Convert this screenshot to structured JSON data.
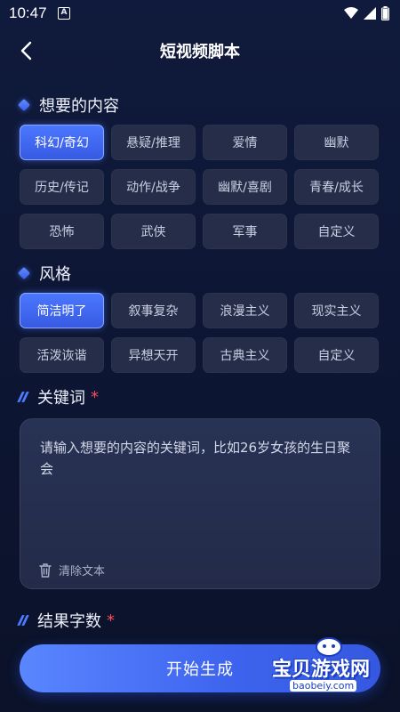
{
  "status_bar": {
    "time": "10:47",
    "notif_letter": "A"
  },
  "header": {
    "title": "短视频脚本"
  },
  "content_section": {
    "title": "想要的内容",
    "options": [
      {
        "label": "科幻/奇幻",
        "selected": true
      },
      {
        "label": "悬疑/推理",
        "selected": false
      },
      {
        "label": "爱情",
        "selected": false
      },
      {
        "label": "幽默",
        "selected": false
      },
      {
        "label": "历史/传记",
        "selected": false
      },
      {
        "label": "动作/战争",
        "selected": false
      },
      {
        "label": "幽默/喜剧",
        "selected": false
      },
      {
        "label": "青春/成长",
        "selected": false
      },
      {
        "label": "恐怖",
        "selected": false
      },
      {
        "label": "武侠",
        "selected": false
      },
      {
        "label": "军事",
        "selected": false
      },
      {
        "label": "自定义",
        "selected": false
      }
    ]
  },
  "style_section": {
    "title": "风格",
    "options": [
      {
        "label": "简洁明了",
        "selected": true
      },
      {
        "label": "叙事复杂",
        "selected": false
      },
      {
        "label": "浪漫主义",
        "selected": false
      },
      {
        "label": "现实主义",
        "selected": false
      },
      {
        "label": "活泼诙谐",
        "selected": false
      },
      {
        "label": "异想天开",
        "selected": false
      },
      {
        "label": "古典主义",
        "selected": false
      },
      {
        "label": "自定义",
        "selected": false
      }
    ]
  },
  "keyword_section": {
    "title": "关键词",
    "required_mark": "*",
    "placeholder": "请输入想要的内容的关键词，比如26岁女孩的生日聚会",
    "clear_label": "清除文本"
  },
  "word_count_section": {
    "title": "结果字数",
    "required_mark": "*"
  },
  "start_button": {
    "label": "开始生成"
  },
  "watermark": {
    "text": "宝贝游戏网",
    "url": "baobeiy.com"
  },
  "colors": {
    "accent": "#4b78ff",
    "chip_bg": "#252d48",
    "required": "#ff4b5c"
  }
}
